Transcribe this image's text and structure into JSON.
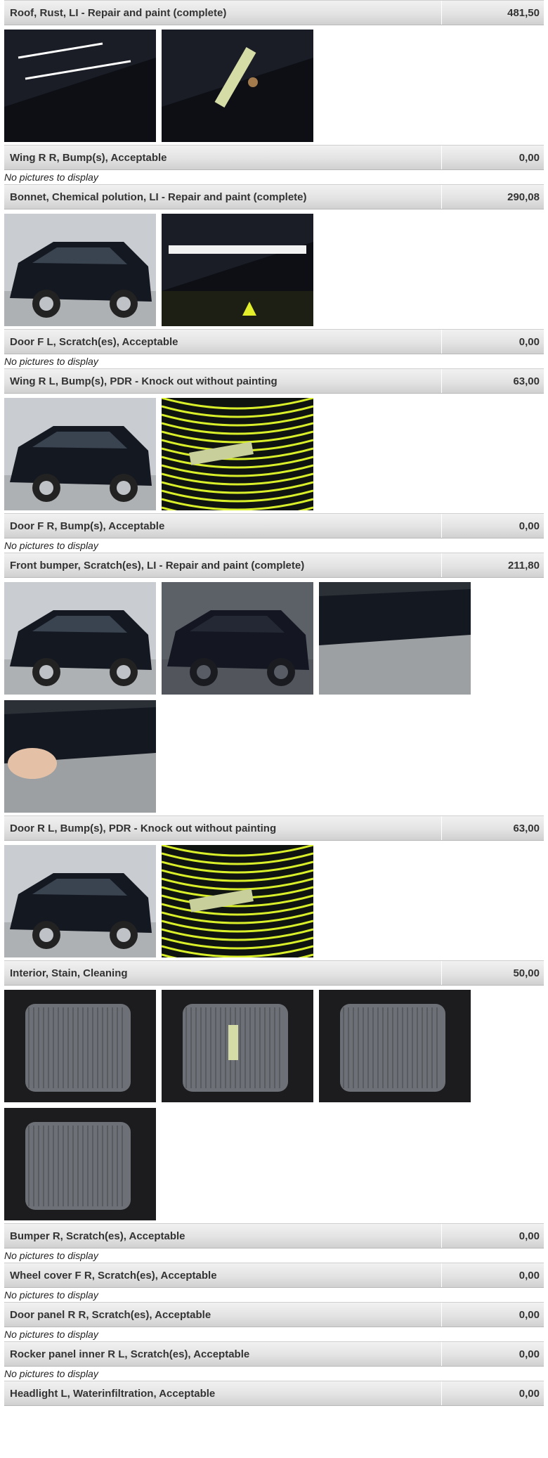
{
  "items": [
    {
      "title": "Roof, Rust, LI - Repair and paint (complete)",
      "price": "481,50",
      "pictures": [
        "roof-overview",
        "roof-rust-closeup"
      ]
    },
    {
      "title": "Wing R R, Bump(s), Acceptable",
      "price": "0,00",
      "note": "No pictures to display"
    },
    {
      "title": "Bonnet, Chemical polution, LI - Repair and paint (complete)",
      "price": "290,08",
      "pictures": [
        "bonnet-overview",
        "bonnet-closeup"
      ]
    },
    {
      "title": "Door F L, Scratch(es), Acceptable",
      "price": "0,00",
      "note": "No pictures to display"
    },
    {
      "title": "Wing R L, Bump(s), PDR - Knock out without painting",
      "price": "63,00",
      "pictures": [
        "wing-rl-overview",
        "wing-rl-reflector"
      ]
    },
    {
      "title": "Door F R, Bump(s), Acceptable",
      "price": "0,00",
      "note": "No pictures to display"
    },
    {
      "title": "Front bumper, Scratch(es), LI - Repair and paint (complete)",
      "price": "211,80",
      "pictures": [
        "front-left",
        "bumper-corner",
        "bumper-under",
        "bumper-hand-gauge"
      ]
    },
    {
      "title": "Door R L, Bump(s), PDR - Knock out without painting",
      "price": "63,00",
      "pictures": [
        "door-rl-side",
        "door-rl-reflector"
      ]
    },
    {
      "title": "Interior, Stain, Cleaning",
      "price": "50,00",
      "pictures": [
        "interior-seat-front",
        "seat-fabric-gauge",
        "interior-driver",
        "seat-cushion"
      ]
    },
    {
      "title": "Bumper R, Scratch(es), Acceptable",
      "price": "0,00",
      "note": "No pictures to display"
    },
    {
      "title": "Wheel cover F R, Scratch(es), Acceptable",
      "price": "0,00",
      "note": "No pictures to display"
    },
    {
      "title": "Door panel R R, Scratch(es), Acceptable",
      "price": "0,00",
      "note": "No pictures to display"
    },
    {
      "title": "Rocker panel inner R L, Scratch(es), Acceptable",
      "price": "0,00",
      "note": "No pictures to display"
    },
    {
      "title": "Headlight L, Waterinfiltration, Acceptable",
      "price": "0,00"
    }
  ],
  "colors": {
    "bar_top": "#f1f1f1",
    "bar_bottom": "#d0d0d0",
    "text": "#333333",
    "car_paint": "#141821",
    "gauge_yellow": "#d9ef2a"
  }
}
